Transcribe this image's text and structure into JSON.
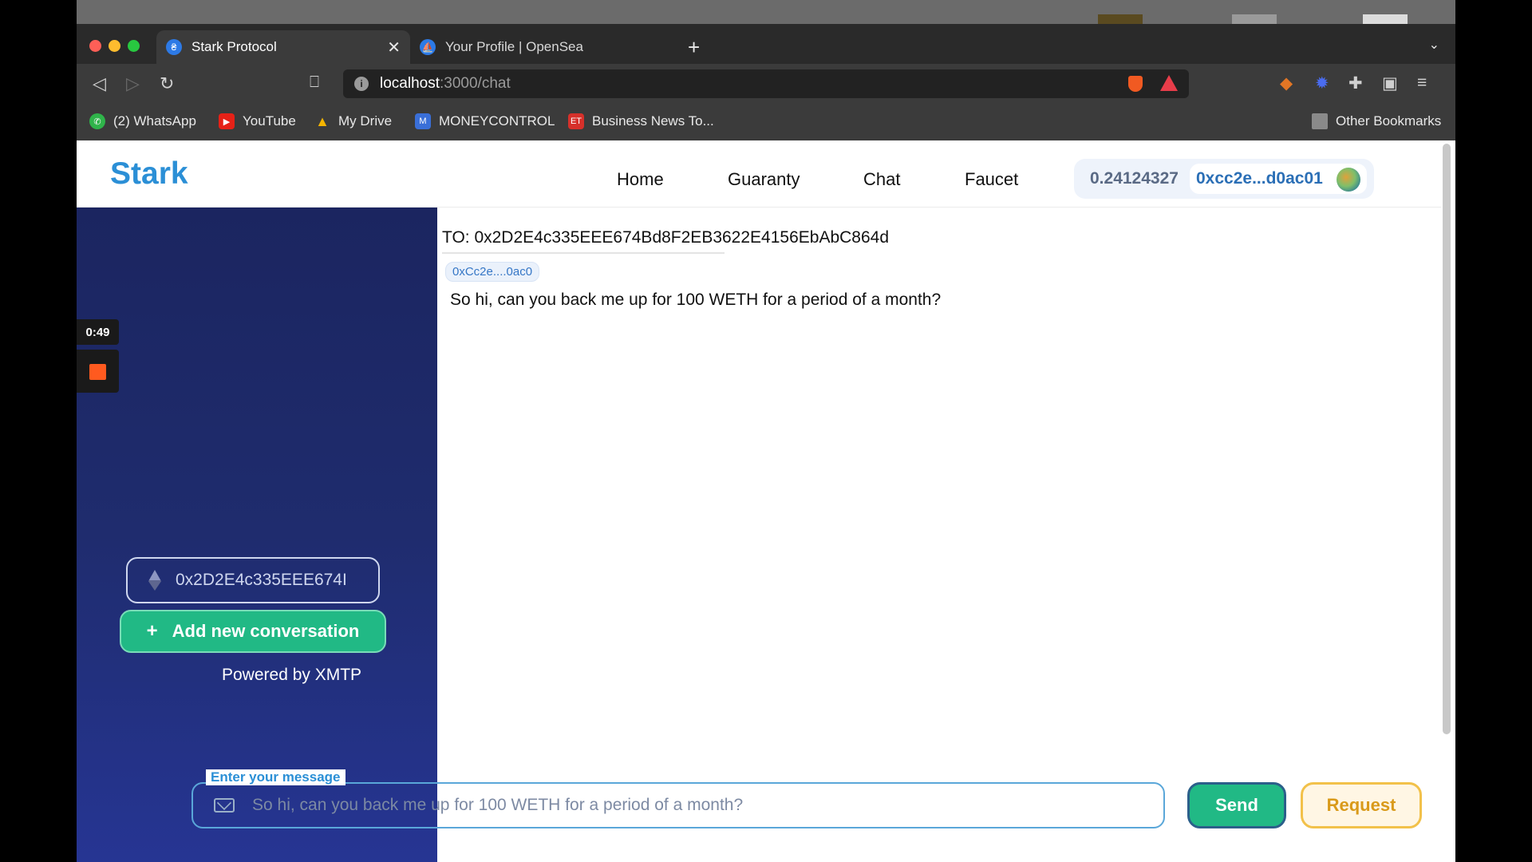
{
  "browser": {
    "tabs": [
      {
        "title": "Stark Protocol",
        "active": true
      },
      {
        "title": "Your Profile | OpenSea",
        "active": false
      }
    ],
    "url_host": "localhost",
    "url_path": ":3000/chat",
    "bookmarks": [
      {
        "label": "(2) WhatsApp",
        "icon": "whatsapp-icon",
        "color": "#2fb44a"
      },
      {
        "label": "YouTube",
        "icon": "youtube-icon",
        "color": "#e62117"
      },
      {
        "label": "My Drive",
        "icon": "drive-icon",
        "color": "#f4b400"
      },
      {
        "label": "MONEYCONTROL",
        "icon": "moneycontrol-icon",
        "color": "#3a6fd8"
      },
      {
        "label": "Business News To...",
        "icon": "et-icon",
        "color": "#d6302a"
      }
    ],
    "other_bookmarks": "Other Bookmarks"
  },
  "site": {
    "logo": "Stark",
    "nav": [
      "Home",
      "Guaranty",
      "Chat",
      "Faucet"
    ],
    "balance": "0.24124327",
    "address": "0xcc2e...d0ac01"
  },
  "recorder": {
    "time": "0:49"
  },
  "sidebar": {
    "address_input_value": "0x2D2E4c335EEE674I",
    "add_button": "Add new conversation",
    "powered_by": "Powered by XMTP"
  },
  "conversation": {
    "to": "TO: 0x2D2E4c335EEE674Bd8F2EB3622E4156EbAbC864d",
    "sender_chip": "0xCc2e....0ac0",
    "message": "So hi, can you back me up for 100 WETH for a period of a month?"
  },
  "composer": {
    "label": "Enter your message",
    "value": "So hi, can you back me up for 100 WETH for a period of a month?",
    "send": "Send",
    "request": "Request"
  },
  "colors": {
    "accent": "#2b8fd6",
    "sidebar": "#1f2c6e",
    "green": "#21b985",
    "request": "#f2c14a"
  }
}
